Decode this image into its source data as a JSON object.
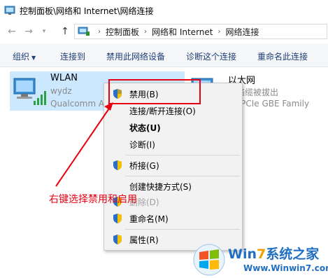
{
  "window": {
    "title": "控制面板\\网络和 Internet\\网络连接"
  },
  "address": {
    "crumbs": [
      "控制面板",
      "网络和 Internet",
      "网络连接"
    ]
  },
  "command_bar": {
    "organize": "组织",
    "connect": "连接到",
    "disable": "禁用此网络设备",
    "diagnose": "诊断这个连接",
    "rename": "重命名此连接"
  },
  "adapters": [
    {
      "name": "WLAN",
      "status": "wydz",
      "device": "Qualcomm At",
      "selected": true
    },
    {
      "name": "以太网",
      "status": "网络缆被拔出",
      "device": "ek PCIe GBE Family",
      "selected": false
    }
  ],
  "context_menu": {
    "items": [
      {
        "label": "禁用(B)",
        "shield": true,
        "bold": false,
        "disabled": false
      },
      {
        "label": "连接/断开连接(O)",
        "shield": false,
        "bold": false,
        "disabled": false
      },
      {
        "label": "状态(U)",
        "shield": false,
        "bold": true,
        "disabled": false
      },
      {
        "label": "诊断(I)",
        "shield": false,
        "bold": false,
        "disabled": false
      },
      {
        "label": "桥接(G)",
        "shield": true,
        "bold": false,
        "disabled": false
      },
      {
        "label": "创建快捷方式(S)",
        "shield": false,
        "bold": false,
        "disabled": false
      },
      {
        "label": "删除(D)",
        "shield": true,
        "bold": false,
        "disabled": true
      },
      {
        "label": "重命名(M)",
        "shield": true,
        "bold": false,
        "disabled": false
      },
      {
        "label": "属性(R)",
        "shield": true,
        "bold": false,
        "disabled": false
      }
    ]
  },
  "annotation": {
    "text": "右键选择禁用和启用",
    "color": "#e60012"
  },
  "watermark": {
    "brand_a": "Win",
    "brand_b": "7",
    "brand_c": "系统之家",
    "url": "Www.Winwin7.com"
  },
  "colors": {
    "selection": "#cce8ff",
    "command_text": "#1e3f78",
    "highlight": "#e60012"
  }
}
